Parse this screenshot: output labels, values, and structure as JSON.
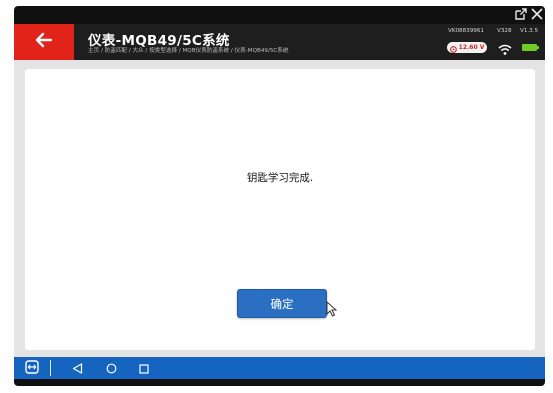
{
  "window": {
    "popout_icon": "external-window-icon",
    "close_icon": "close-icon"
  },
  "header": {
    "title": "仪表-MQB49/5C系统",
    "breadcrumb": "主页 / 防盗匹配 / 大众 / 按类型选择 / MQB仪表防盗系统 / 仪表-MQB49/5C系统",
    "vin": "VK08839961",
    "sw": "V328",
    "version": "V1.3.5",
    "voltage": "12.60 V",
    "colors": {
      "accent": "#e2231a",
      "header_bg": "#1e1e1e",
      "battery": "#6ecb2a",
      "voltage_text": "#c9252b"
    }
  },
  "dialog": {
    "message": "钥匙学习完成.",
    "ok_label": "确定",
    "button_color": "#2b6fc2"
  },
  "navbar": {
    "color": "#1565c0",
    "icons": [
      "remote-icon",
      "back-triangle-icon",
      "home-circle-icon",
      "recents-square-icon"
    ]
  }
}
